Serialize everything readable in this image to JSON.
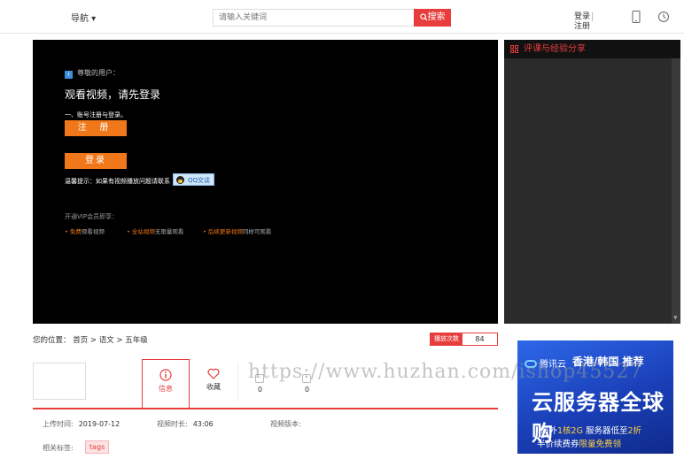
{
  "header": {
    "nav_label": "导航 ▾",
    "search_placeholder": "请输入关键词",
    "search_button": "搜索",
    "login": "登录",
    "register": "注册"
  },
  "player": {
    "greeting": "尊敬的用户：",
    "title": "观看视频，请先登录",
    "step1": "一、账号注册与登录。",
    "register_button": "注 册",
    "login_button": "登录",
    "hint": "温馨提示：如果有视频播放问题请联系",
    "qq_button": "QQ交谈",
    "vip_heading": "开通VIP会员即享：",
    "perks": [
      {
        "highlight": "免费",
        "text": "观看视频"
      },
      {
        "highlight": "全站视频",
        "text": "无限量观看"
      },
      {
        "highlight": "后续更新视频",
        "text": "同样可观看"
      }
    ]
  },
  "side_panel": {
    "title": "评课与经验分享"
  },
  "location": {
    "text": "您的位置： 首页 > 语文 > 五年级"
  },
  "plays": {
    "label": "播放次数",
    "value": "84"
  },
  "tabs": {
    "info": "信息",
    "favorite": "收藏"
  },
  "stats": {
    "a": "0",
    "b": "0"
  },
  "meta": {
    "upload_label": "上传时间:",
    "upload_value": "2019-07-12",
    "duration_label": "视频时长:",
    "duration_value": "43:06",
    "version_label": "视频版本:",
    "version_value": "",
    "tags_label": "相关标签:",
    "tag": "tags"
  },
  "ad": {
    "brand": "腾讯云",
    "region": "香港/韩国 推荐",
    "headline": "云服务器全球购",
    "line1_a": "海外",
    "line1_hl1": "1核2G",
    "line1_b": " 服务器低至",
    "line1_hl2": "2折",
    "line2_a": "半价续费券",
    "line2_hl": "限量免费领"
  },
  "watermark": "https://www.huzhan.com/ishop45527"
}
